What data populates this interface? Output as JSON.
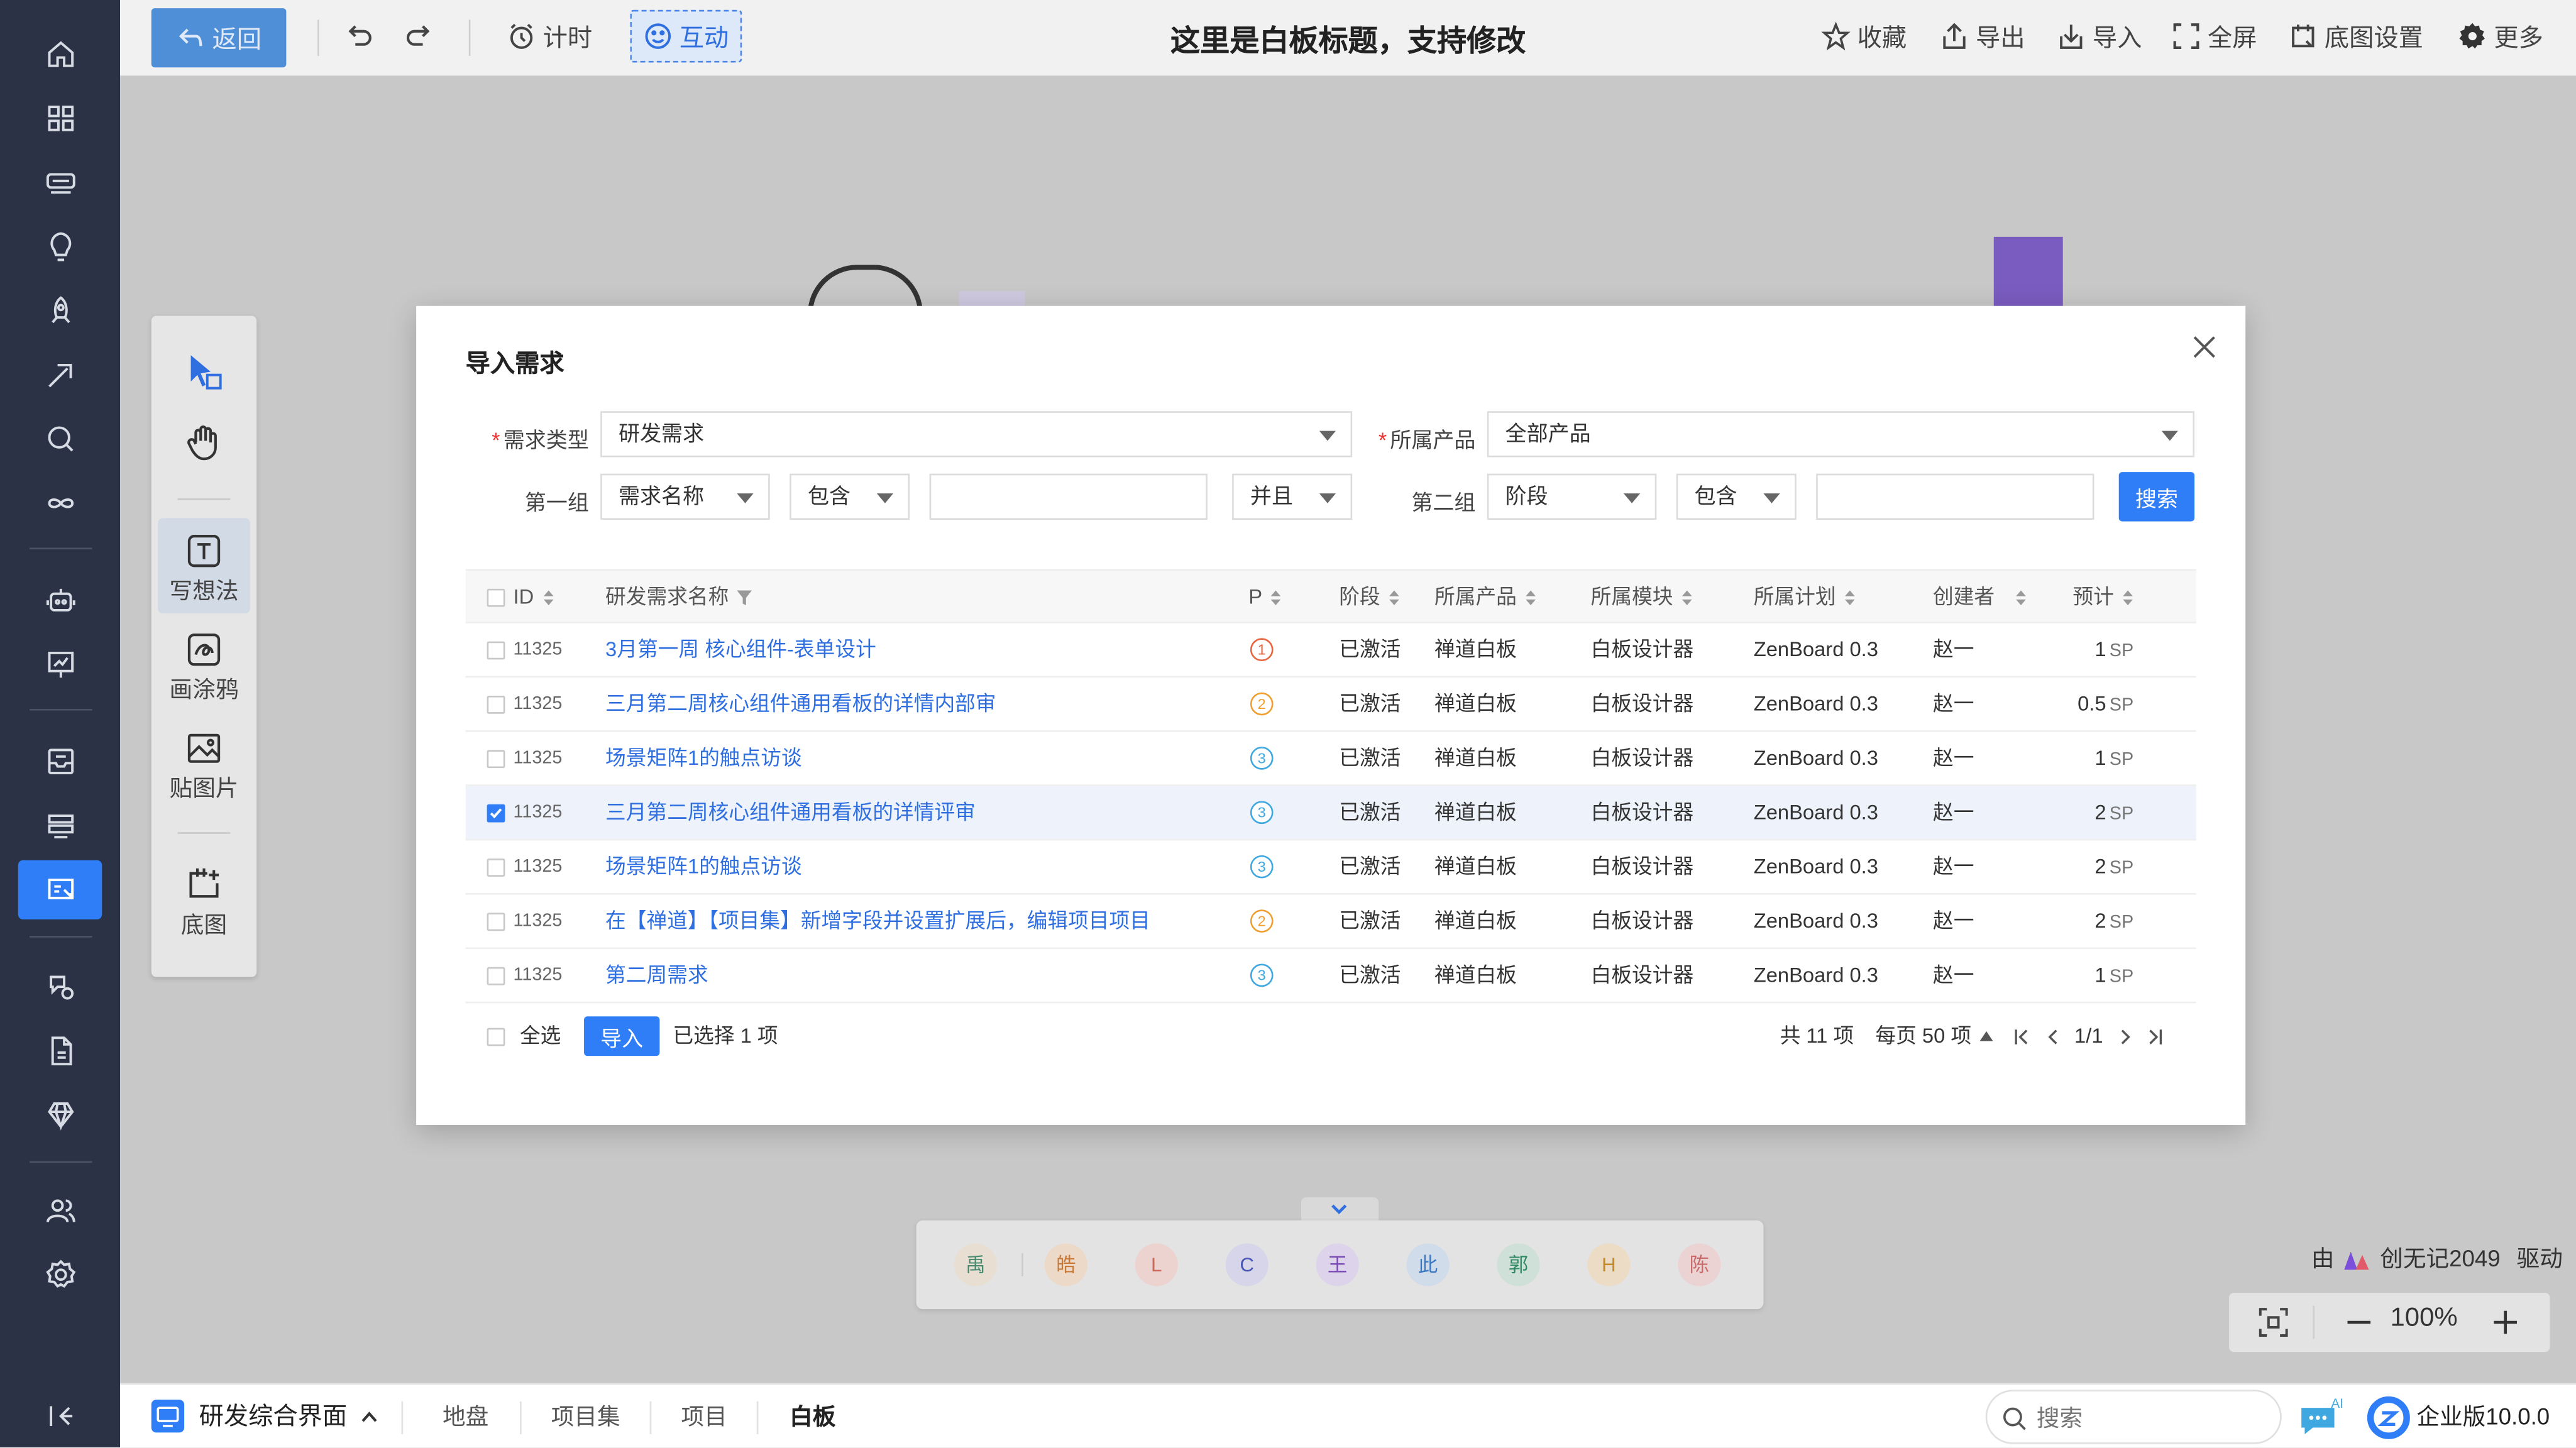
{
  "topbar": {
    "back": "返回",
    "timer": "计时",
    "interact": "互动",
    "title": "这里是白板标题，支持修改",
    "favorite": "收藏",
    "export": "导出",
    "import": "导入",
    "fullscreen": "全屏",
    "bg_settings": "底图设置",
    "more": "更多"
  },
  "tools": {
    "write": "写想法",
    "draw": "画涂鸦",
    "image": "贴图片",
    "background": "底图"
  },
  "modal": {
    "title": "导入需求",
    "filters": {
      "type_label": "需求类型",
      "type_value": "研发需求",
      "product_label": "所属产品",
      "product_value": "全部产品",
      "group1_label": "第一组",
      "group1_field": "需求名称",
      "group1_op": "包含",
      "group1_value": "",
      "join": "并且",
      "group2_label": "第二组",
      "group2_field": "阶段",
      "group2_op": "包含",
      "group2_value": "",
      "search": "搜索"
    },
    "columns": {
      "id": "ID",
      "name": "研发需求名称",
      "pri": "P",
      "stage": "阶段",
      "product": "所属产品",
      "module": "所属模块",
      "plan": "所属计划",
      "creator": "创建者",
      "estimate": "预计"
    },
    "rows": [
      {
        "id": "11325",
        "name": "3月第一周 核心组件-表单设计",
        "pri": "1",
        "stage": "已激活",
        "product": "禅道白板",
        "module": "白板设计器",
        "plan": "ZenBoard 0.3",
        "creator": "赵一",
        "estimate": "1",
        "unit": "SP",
        "checked": false
      },
      {
        "id": "11325",
        "name": "三月第二周核心组件通用看板的详情内部审",
        "pri": "2",
        "stage": "已激活",
        "product": "禅道白板",
        "module": "白板设计器",
        "plan": "ZenBoard 0.3",
        "creator": "赵一",
        "estimate": "0.5",
        "unit": "SP",
        "checked": false
      },
      {
        "id": "11325",
        "name": "场景矩阵1的触点访谈",
        "pri": "3",
        "stage": "已激活",
        "product": "禅道白板",
        "module": "白板设计器",
        "plan": "ZenBoard 0.3",
        "creator": "赵一",
        "estimate": "1",
        "unit": "SP",
        "checked": false
      },
      {
        "id": "11325",
        "name": "三月第二周核心组件通用看板的详情评审",
        "pri": "3",
        "stage": "已激活",
        "product": "禅道白板",
        "module": "白板设计器",
        "plan": "ZenBoard 0.3",
        "creator": "赵一",
        "estimate": "2",
        "unit": "SP",
        "checked": true
      },
      {
        "id": "11325",
        "name": "场景矩阵1的触点访谈",
        "pri": "3",
        "stage": "已激活",
        "product": "禅道白板",
        "module": "白板设计器",
        "plan": "ZenBoard 0.3",
        "creator": "赵一",
        "estimate": "2",
        "unit": "SP",
        "checked": false
      },
      {
        "id": "11325",
        "name": "在【禅道】【项目集】新增字段并设置扩展后，编辑项目项目",
        "pri": "2",
        "stage": "已激活",
        "product": "禅道白板",
        "module": "白板设计器",
        "plan": "ZenBoard 0.3",
        "creator": "赵一",
        "estimate": "2",
        "unit": "SP",
        "checked": false
      },
      {
        "id": "11325",
        "name": "第二周需求",
        "pri": "3",
        "stage": "已激活",
        "product": "禅道白板",
        "module": "白板设计器",
        "plan": "ZenBoard 0.3",
        "creator": "赵一",
        "estimate": "1",
        "unit": "SP",
        "checked": false
      }
    ],
    "footer": {
      "select_all": "全选",
      "import": "导入",
      "selected": "已选择 1 项",
      "total": "共 11 项",
      "per_page": "每页 50 项",
      "page": "1/1"
    }
  },
  "participants": [
    "禹",
    "皓",
    "L",
    "C",
    "王",
    "此",
    "郭",
    "H",
    "陈"
  ],
  "powered": {
    "prefix": "由",
    "brand": "创无记2049",
    "suffix": "驱动"
  },
  "zoom": {
    "level": "100%"
  },
  "bottombar": {
    "workspace": "研发综合界面",
    "tabs": [
      "地盘",
      "项目集",
      "项目",
      "白板"
    ],
    "search_placeholder": "搜索",
    "edition": "企业版10.0.0"
  },
  "colors": {
    "accent": "#2f7ef7",
    "sidebar": "#2b3245",
    "pri1": "#e8643c",
    "pri2": "#f0a030",
    "pri3": "#3fa8e0"
  }
}
